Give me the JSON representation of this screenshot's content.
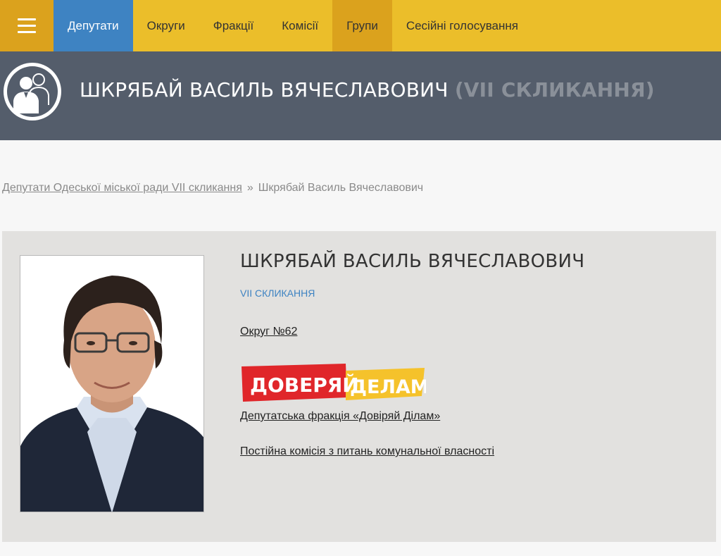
{
  "nav": {
    "items": [
      {
        "label": "Депутати"
      },
      {
        "label": "Округи"
      },
      {
        "label": "Фракції"
      },
      {
        "label": "Комісії"
      },
      {
        "label": "Групи"
      },
      {
        "label": "Сесійні голосування"
      }
    ]
  },
  "header": {
    "title": "ШКРЯБАЙ ВАСИЛЬ ВЯЧЕСЛАВОВИЧ",
    "convocation": "(VII СКЛИКАННЯ)"
  },
  "breadcrumb": {
    "parent": "Депутати Одеської міської ради VII скликання",
    "separator": "»",
    "current": "Шкрябай Василь Вячеславович"
  },
  "profile": {
    "name": "ШКРЯБАЙ ВАСИЛЬ ВЯЧЕСЛАВОВИЧ",
    "convocation": "VII СКЛИКАННЯ",
    "district": "Округ №62",
    "party_logo": {
      "word1": "ДОВЕРЯЙ",
      "word2": "ДЕЛАМ"
    },
    "faction": "Депутатська фракція «Довіряй Ділам»",
    "commission": "Постійна комісія з питань комунальної власності"
  },
  "colors": {
    "nav_bg": "#ebbe2a",
    "nav_highlight": "#dba21d",
    "nav_active": "#3e83c2",
    "header_band": "#545d6b",
    "card_bg": "#e2e1df",
    "link_blue": "#3e83c2",
    "logo_red": "#e0262a",
    "logo_yellow": "#f5c22b"
  }
}
